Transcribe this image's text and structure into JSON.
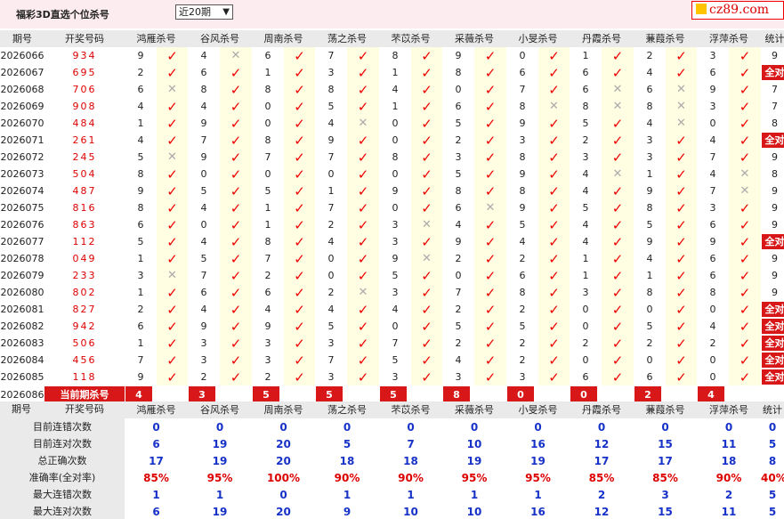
{
  "page": {
    "title": "福彩3D直选个位杀号",
    "period_select": "近20期",
    "logo_text": "cz89.com"
  },
  "colors": {
    "accent_red": "#d81818",
    "stat_blue": "#1732c8",
    "header_bg": "#eaeaea",
    "mark_bg": "#fffde2"
  },
  "columns": {
    "period": "期号",
    "winning": "开奖号码",
    "experts": [
      "鸿雁杀号",
      "谷风杀号",
      "周南杀号",
      "荡之杀号",
      "芣苡杀号",
      "采薇杀号",
      "小旻杀号",
      "丹霞杀号",
      "蒹葭杀号",
      "浮萍杀号"
    ],
    "stat": "统计"
  },
  "rows": [
    {
      "period": "2026066",
      "winning": "934",
      "picks": [
        {
          "n": "9",
          "ok": true
        },
        {
          "n": "4",
          "ok": false
        },
        {
          "n": "6",
          "ok": true
        },
        {
          "n": "7",
          "ok": true
        },
        {
          "n": "8",
          "ok": true
        },
        {
          "n": "9",
          "ok": true
        },
        {
          "n": "0",
          "ok": true
        },
        {
          "n": "1",
          "ok": true
        },
        {
          "n": "2",
          "ok": true
        },
        {
          "n": "3",
          "ok": true
        }
      ],
      "stat": "9"
    },
    {
      "period": "2026067",
      "winning": "695",
      "picks": [
        {
          "n": "2",
          "ok": true
        },
        {
          "n": "6",
          "ok": true
        },
        {
          "n": "1",
          "ok": true
        },
        {
          "n": "3",
          "ok": true
        },
        {
          "n": "1",
          "ok": true
        },
        {
          "n": "8",
          "ok": true
        },
        {
          "n": "6",
          "ok": true
        },
        {
          "n": "6",
          "ok": true
        },
        {
          "n": "4",
          "ok": true
        },
        {
          "n": "6",
          "ok": true
        }
      ],
      "stat": "全对"
    },
    {
      "period": "2026068",
      "winning": "706",
      "picks": [
        {
          "n": "6",
          "ok": false
        },
        {
          "n": "8",
          "ok": true
        },
        {
          "n": "8",
          "ok": true
        },
        {
          "n": "8",
          "ok": true
        },
        {
          "n": "4",
          "ok": true
        },
        {
          "n": "0",
          "ok": true
        },
        {
          "n": "7",
          "ok": true
        },
        {
          "n": "6",
          "ok": false
        },
        {
          "n": "6",
          "ok": false
        },
        {
          "n": "9",
          "ok": true
        }
      ],
      "stat": "7"
    },
    {
      "period": "2026069",
      "winning": "908",
      "picks": [
        {
          "n": "4",
          "ok": true
        },
        {
          "n": "4",
          "ok": true
        },
        {
          "n": "0",
          "ok": true
        },
        {
          "n": "5",
          "ok": true
        },
        {
          "n": "1",
          "ok": true
        },
        {
          "n": "6",
          "ok": true
        },
        {
          "n": "8",
          "ok": false
        },
        {
          "n": "8",
          "ok": false
        },
        {
          "n": "8",
          "ok": false
        },
        {
          "n": "3",
          "ok": true
        }
      ],
      "stat": "7"
    },
    {
      "period": "2026070",
      "winning": "484",
      "picks": [
        {
          "n": "1",
          "ok": true
        },
        {
          "n": "9",
          "ok": true
        },
        {
          "n": "0",
          "ok": true
        },
        {
          "n": "4",
          "ok": false
        },
        {
          "n": "0",
          "ok": true
        },
        {
          "n": "5",
          "ok": true
        },
        {
          "n": "9",
          "ok": true
        },
        {
          "n": "5",
          "ok": true
        },
        {
          "n": "4",
          "ok": false
        },
        {
          "n": "0",
          "ok": true
        }
      ],
      "stat": "8"
    },
    {
      "period": "2026071",
      "winning": "261",
      "picks": [
        {
          "n": "4",
          "ok": true
        },
        {
          "n": "7",
          "ok": true
        },
        {
          "n": "8",
          "ok": true
        },
        {
          "n": "9",
          "ok": true
        },
        {
          "n": "0",
          "ok": true
        },
        {
          "n": "2",
          "ok": true
        },
        {
          "n": "3",
          "ok": true
        },
        {
          "n": "2",
          "ok": true
        },
        {
          "n": "3",
          "ok": true
        },
        {
          "n": "4",
          "ok": true
        }
      ],
      "stat": "全对"
    },
    {
      "period": "2026072",
      "winning": "245",
      "picks": [
        {
          "n": "5",
          "ok": false
        },
        {
          "n": "9",
          "ok": true
        },
        {
          "n": "7",
          "ok": true
        },
        {
          "n": "7",
          "ok": true
        },
        {
          "n": "8",
          "ok": true
        },
        {
          "n": "3",
          "ok": true
        },
        {
          "n": "8",
          "ok": true
        },
        {
          "n": "3",
          "ok": true
        },
        {
          "n": "3",
          "ok": true
        },
        {
          "n": "7",
          "ok": true
        }
      ],
      "stat": "9"
    },
    {
      "period": "2026073",
      "winning": "504",
      "picks": [
        {
          "n": "8",
          "ok": true
        },
        {
          "n": "0",
          "ok": true
        },
        {
          "n": "0",
          "ok": true
        },
        {
          "n": "0",
          "ok": true
        },
        {
          "n": "0",
          "ok": true
        },
        {
          "n": "5",
          "ok": true
        },
        {
          "n": "9",
          "ok": true
        },
        {
          "n": "4",
          "ok": false
        },
        {
          "n": "1",
          "ok": true
        },
        {
          "n": "4",
          "ok": false
        }
      ],
      "stat": "8"
    },
    {
      "period": "2026074",
      "winning": "487",
      "picks": [
        {
          "n": "9",
          "ok": true
        },
        {
          "n": "5",
          "ok": true
        },
        {
          "n": "5",
          "ok": true
        },
        {
          "n": "1",
          "ok": true
        },
        {
          "n": "9",
          "ok": true
        },
        {
          "n": "8",
          "ok": true
        },
        {
          "n": "8",
          "ok": true
        },
        {
          "n": "4",
          "ok": true
        },
        {
          "n": "9",
          "ok": true
        },
        {
          "n": "7",
          "ok": false
        }
      ],
      "stat": "9"
    },
    {
      "period": "2026075",
      "winning": "816",
      "picks": [
        {
          "n": "8",
          "ok": true
        },
        {
          "n": "4",
          "ok": true
        },
        {
          "n": "1",
          "ok": true
        },
        {
          "n": "7",
          "ok": true
        },
        {
          "n": "0",
          "ok": true
        },
        {
          "n": "6",
          "ok": false
        },
        {
          "n": "9",
          "ok": true
        },
        {
          "n": "5",
          "ok": true
        },
        {
          "n": "8",
          "ok": true
        },
        {
          "n": "3",
          "ok": true
        }
      ],
      "stat": "9"
    },
    {
      "period": "2026076",
      "winning": "863",
      "picks": [
        {
          "n": "6",
          "ok": true
        },
        {
          "n": "0",
          "ok": true
        },
        {
          "n": "1",
          "ok": true
        },
        {
          "n": "2",
          "ok": true
        },
        {
          "n": "3",
          "ok": false
        },
        {
          "n": "4",
          "ok": true
        },
        {
          "n": "5",
          "ok": true
        },
        {
          "n": "4",
          "ok": true
        },
        {
          "n": "5",
          "ok": true
        },
        {
          "n": "6",
          "ok": true
        }
      ],
      "stat": "9"
    },
    {
      "period": "2026077",
      "winning": "112",
      "picks": [
        {
          "n": "5",
          "ok": true
        },
        {
          "n": "4",
          "ok": true
        },
        {
          "n": "8",
          "ok": true
        },
        {
          "n": "4",
          "ok": true
        },
        {
          "n": "3",
          "ok": true
        },
        {
          "n": "9",
          "ok": true
        },
        {
          "n": "4",
          "ok": true
        },
        {
          "n": "4",
          "ok": true
        },
        {
          "n": "9",
          "ok": true
        },
        {
          "n": "9",
          "ok": true
        }
      ],
      "stat": "全对"
    },
    {
      "period": "2026078",
      "winning": "049",
      "picks": [
        {
          "n": "1",
          "ok": true
        },
        {
          "n": "5",
          "ok": true
        },
        {
          "n": "7",
          "ok": true
        },
        {
          "n": "0",
          "ok": true
        },
        {
          "n": "9",
          "ok": false
        },
        {
          "n": "2",
          "ok": true
        },
        {
          "n": "2",
          "ok": true
        },
        {
          "n": "1",
          "ok": true
        },
        {
          "n": "4",
          "ok": true
        },
        {
          "n": "6",
          "ok": true
        }
      ],
      "stat": "9"
    },
    {
      "period": "2026079",
      "winning": "233",
      "picks": [
        {
          "n": "3",
          "ok": false
        },
        {
          "n": "7",
          "ok": true
        },
        {
          "n": "2",
          "ok": true
        },
        {
          "n": "0",
          "ok": true
        },
        {
          "n": "5",
          "ok": true
        },
        {
          "n": "0",
          "ok": true
        },
        {
          "n": "6",
          "ok": true
        },
        {
          "n": "1",
          "ok": true
        },
        {
          "n": "1",
          "ok": true
        },
        {
          "n": "6",
          "ok": true
        }
      ],
      "stat": "9"
    },
    {
      "period": "2026080",
      "winning": "802",
      "picks": [
        {
          "n": "1",
          "ok": true
        },
        {
          "n": "6",
          "ok": true
        },
        {
          "n": "6",
          "ok": true
        },
        {
          "n": "2",
          "ok": false
        },
        {
          "n": "3",
          "ok": true
        },
        {
          "n": "7",
          "ok": true
        },
        {
          "n": "8",
          "ok": true
        },
        {
          "n": "3",
          "ok": true
        },
        {
          "n": "8",
          "ok": true
        },
        {
          "n": "8",
          "ok": true
        }
      ],
      "stat": "9"
    },
    {
      "period": "2026081",
      "winning": "827",
      "picks": [
        {
          "n": "2",
          "ok": true
        },
        {
          "n": "4",
          "ok": true
        },
        {
          "n": "4",
          "ok": true
        },
        {
          "n": "4",
          "ok": true
        },
        {
          "n": "4",
          "ok": true
        },
        {
          "n": "2",
          "ok": true
        },
        {
          "n": "2",
          "ok": true
        },
        {
          "n": "0",
          "ok": true
        },
        {
          "n": "0",
          "ok": true
        },
        {
          "n": "0",
          "ok": true
        }
      ],
      "stat": "全对"
    },
    {
      "period": "2026082",
      "winning": "942",
      "picks": [
        {
          "n": "6",
          "ok": true
        },
        {
          "n": "9",
          "ok": true
        },
        {
          "n": "9",
          "ok": true
        },
        {
          "n": "5",
          "ok": true
        },
        {
          "n": "0",
          "ok": true
        },
        {
          "n": "5",
          "ok": true
        },
        {
          "n": "5",
          "ok": true
        },
        {
          "n": "0",
          "ok": true
        },
        {
          "n": "5",
          "ok": true
        },
        {
          "n": "4",
          "ok": true
        }
      ],
      "stat": "全对"
    },
    {
      "period": "2026083",
      "winning": "506",
      "picks": [
        {
          "n": "1",
          "ok": true
        },
        {
          "n": "3",
          "ok": true
        },
        {
          "n": "3",
          "ok": true
        },
        {
          "n": "3",
          "ok": true
        },
        {
          "n": "7",
          "ok": true
        },
        {
          "n": "2",
          "ok": true
        },
        {
          "n": "2",
          "ok": true
        },
        {
          "n": "2",
          "ok": true
        },
        {
          "n": "2",
          "ok": true
        },
        {
          "n": "2",
          "ok": true
        }
      ],
      "stat": "全对"
    },
    {
      "period": "2026084",
      "winning": "456",
      "picks": [
        {
          "n": "7",
          "ok": true
        },
        {
          "n": "3",
          "ok": true
        },
        {
          "n": "3",
          "ok": true
        },
        {
          "n": "7",
          "ok": true
        },
        {
          "n": "5",
          "ok": true
        },
        {
          "n": "4",
          "ok": true
        },
        {
          "n": "2",
          "ok": true
        },
        {
          "n": "0",
          "ok": true
        },
        {
          "n": "0",
          "ok": true
        },
        {
          "n": "0",
          "ok": true
        }
      ],
      "stat": "全对"
    },
    {
      "period": "2026085",
      "winning": "118",
      "picks": [
        {
          "n": "9",
          "ok": true
        },
        {
          "n": "2",
          "ok": true
        },
        {
          "n": "2",
          "ok": true
        },
        {
          "n": "3",
          "ok": true
        },
        {
          "n": "3",
          "ok": true
        },
        {
          "n": "3",
          "ok": true
        },
        {
          "n": "3",
          "ok": true
        },
        {
          "n": "6",
          "ok": true
        },
        {
          "n": "6",
          "ok": true
        },
        {
          "n": "0",
          "ok": true
        }
      ],
      "stat": "全对"
    }
  ],
  "current": {
    "period": "2026086",
    "label": "当前期杀号",
    "picks": [
      "4",
      "3",
      "5",
      "5",
      "5",
      "8",
      "0",
      "0",
      "2",
      "4"
    ]
  },
  "stats": {
    "rows": [
      {
        "label": "目前连错次数",
        "values": [
          "0",
          "0",
          "0",
          "0",
          "0",
          "0",
          "0",
          "0",
          "0",
          "0",
          "0"
        ]
      },
      {
        "label": "目前连对次数",
        "values": [
          "6",
          "19",
          "20",
          "5",
          "7",
          "10",
          "16",
          "12",
          "15",
          "11",
          "5"
        ]
      },
      {
        "label": "总正确次数",
        "values": [
          "17",
          "19",
          "20",
          "18",
          "18",
          "19",
          "19",
          "17",
          "17",
          "18",
          "8"
        ]
      },
      {
        "label": "准确率(全对率)",
        "values": [
          "85%",
          "95%",
          "100%",
          "90%",
          "90%",
          "95%",
          "95%",
          "85%",
          "85%",
          "90%",
          "40%"
        ],
        "red": true
      },
      {
        "label": "最大连错次数",
        "values": [
          "1",
          "1",
          "0",
          "1",
          "1",
          "1",
          "1",
          "2",
          "3",
          "2",
          "5"
        ]
      },
      {
        "label": "最大连对次数",
        "values": [
          "6",
          "19",
          "20",
          "9",
          "10",
          "10",
          "16",
          "12",
          "15",
          "11",
          "5"
        ]
      }
    ]
  }
}
